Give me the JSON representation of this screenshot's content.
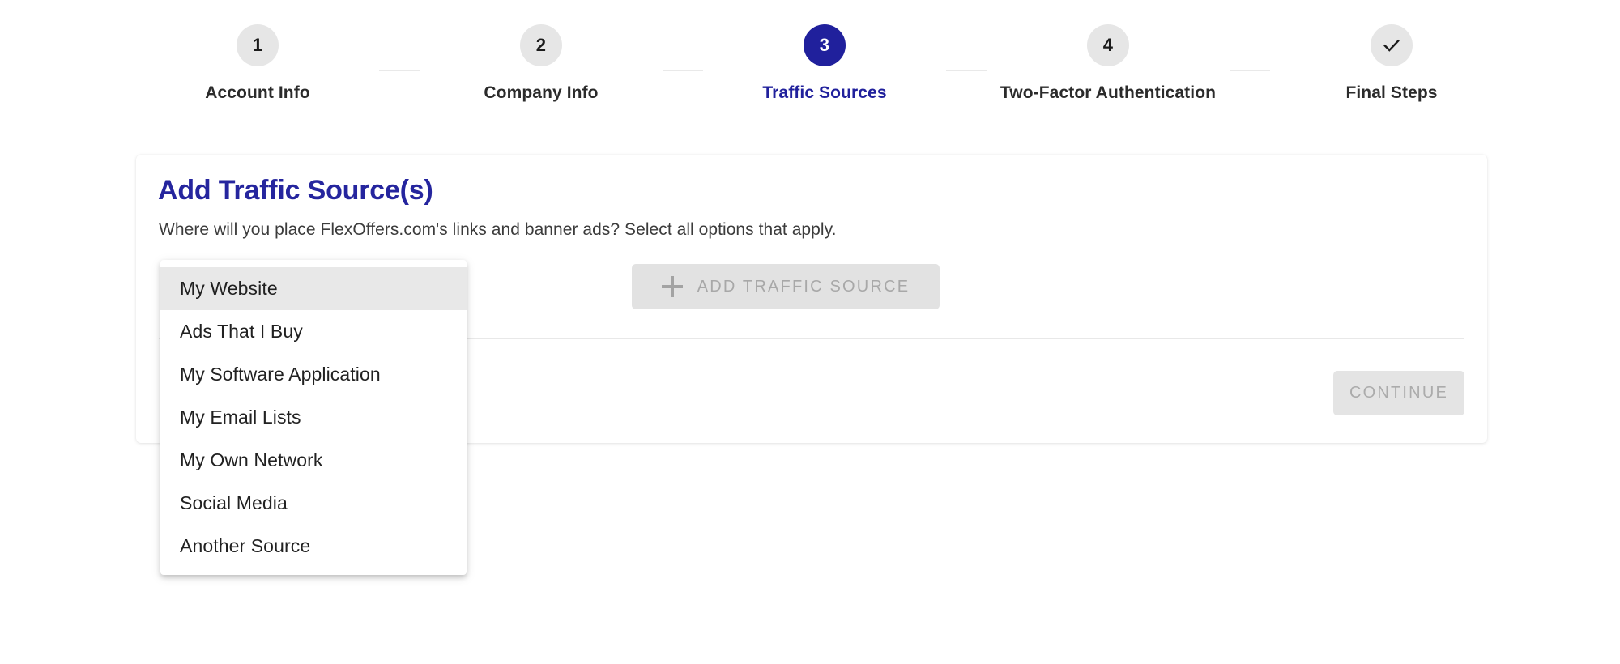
{
  "stepper": {
    "steps": [
      {
        "indicator": "1",
        "label": "Account Info",
        "state": "inactive",
        "icon": "none"
      },
      {
        "indicator": "2",
        "label": "Company Info",
        "state": "inactive",
        "icon": "none"
      },
      {
        "indicator": "3",
        "label": "Traffic Sources",
        "state": "active",
        "icon": "none"
      },
      {
        "indicator": "4",
        "label": "Two-Factor Authentication",
        "state": "inactive",
        "icon": "none"
      },
      {
        "indicator": "",
        "label": "Final Steps",
        "state": "inactive",
        "icon": "check-icon"
      }
    ],
    "active_color": "#20209c",
    "inactive_circle_color": "#e6e6e6"
  },
  "card": {
    "title": "Add Traffic Source(s)",
    "title_color": "#25259e",
    "subtitle": "Where will you place FlexOffers.com's links and banner ads? Select all options that apply.",
    "add_button": {
      "label": "ADD TRAFFIC SOURCE",
      "icon": "plus-icon",
      "disabled": true
    },
    "continue_button": {
      "label": "CONTINUE",
      "disabled": true
    }
  },
  "dropdown": {
    "open": true,
    "highlighted_index": 0,
    "options": [
      "My Website",
      "Ads That I Buy",
      "My Software Application",
      "My Email Lists",
      "My Own Network",
      "Social Media",
      "Another Source"
    ]
  }
}
